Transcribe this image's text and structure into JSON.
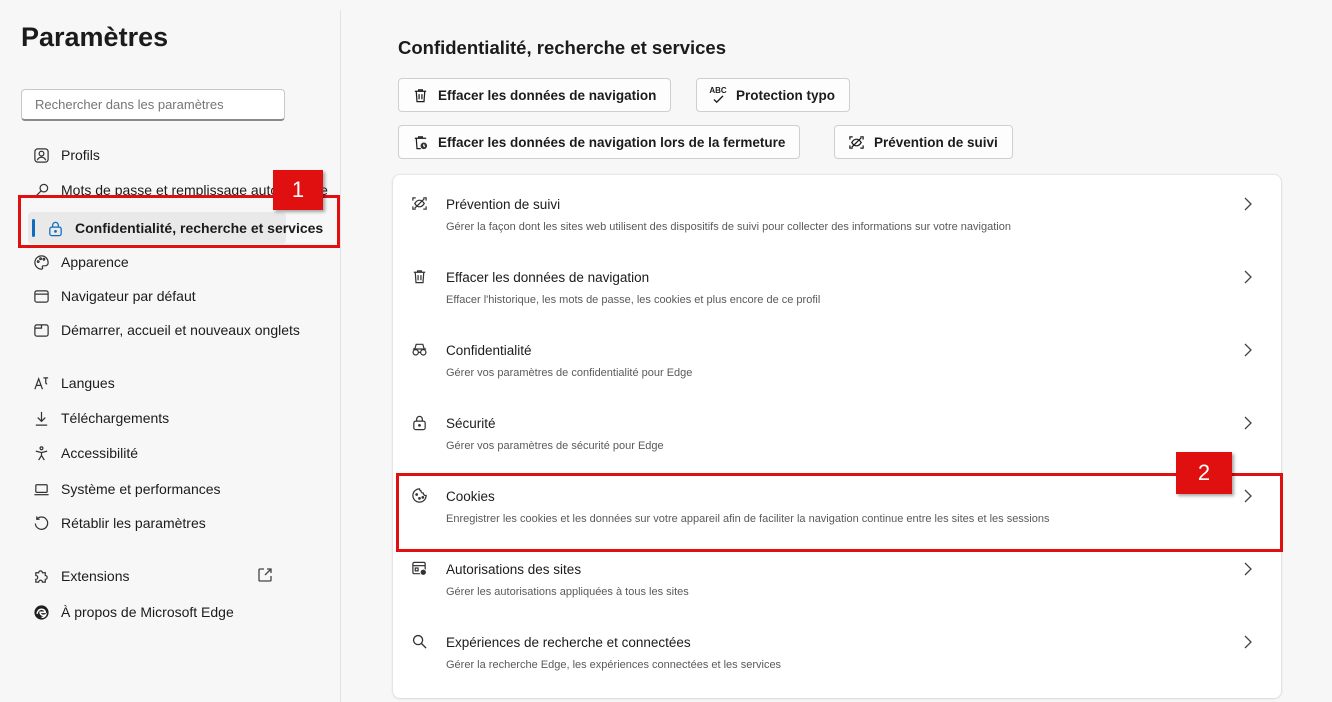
{
  "sidebar": {
    "title": "Paramètres",
    "search_placeholder": "Rechercher dans les paramètres",
    "items": [
      {
        "label": "Profils",
        "icon": "profile-icon"
      },
      {
        "label": "Mots de passe et remplissage automatique",
        "icon": "key-icon"
      },
      {
        "label": "Confidentialité, recherche et services",
        "icon": "lock-icon",
        "active": true
      },
      {
        "label": "Apparence",
        "icon": "palette-icon"
      },
      {
        "label": "Navigateur par défaut",
        "icon": "browser-icon"
      },
      {
        "label": "Démarrer, accueil et nouveaux onglets",
        "icon": "tab-icon"
      },
      {
        "label": "Langues",
        "icon": "language-icon"
      },
      {
        "label": "Téléchargements",
        "icon": "download-icon"
      },
      {
        "label": "Accessibilité",
        "icon": "accessibility-icon"
      },
      {
        "label": "Système et performances",
        "icon": "laptop-icon"
      },
      {
        "label": "Rétablir les paramètres",
        "icon": "reset-icon"
      },
      {
        "label": "Extensions",
        "icon": "puzzle-icon"
      },
      {
        "label": "À propos de Microsoft Edge",
        "icon": "edge-logo-icon"
      }
    ]
  },
  "main": {
    "title": "Confidentialité, recherche et services",
    "quick_buttons": [
      {
        "label": "Effacer les données de navigation",
        "icon": "trash-icon"
      },
      {
        "label": "Protection typo",
        "icon": "spellcheck-icon",
        "icon_text": "ABC"
      },
      {
        "label": "Effacer les données de navigation lors de la fermeture",
        "icon": "trash-clock-icon"
      },
      {
        "label": "Prévention de suivi",
        "icon": "tracking-icon"
      }
    ],
    "rows": [
      {
        "label": "Prévention de suivi",
        "desc": "Gérer la façon dont les sites web utilisent des dispositifs de suivi pour collecter des informations sur votre navigation",
        "icon": "tracking-icon"
      },
      {
        "label": "Effacer les données de navigation",
        "desc": "Effacer l'historique, les mots de passe, les cookies et plus encore de ce profil",
        "icon": "trash-icon"
      },
      {
        "label": "Confidentialité",
        "desc": "Gérer vos paramètres de confidentialité pour Edge",
        "icon": "glasses-icon"
      },
      {
        "label": "Sécurité",
        "desc": "Gérer vos paramètres de sécurité pour Edge",
        "icon": "lock-icon"
      },
      {
        "label": "Cookies",
        "desc": "Enregistrer les cookies et les données sur votre appareil afin de faciliter la navigation continue entre les sites et les sessions",
        "icon": "cookie-icon"
      },
      {
        "label": "Autorisations des sites",
        "desc": "Gérer les autorisations appliquées à tous les sites",
        "icon": "site-permissions-icon"
      },
      {
        "label": "Expériences de recherche et connectées",
        "desc": "Gérer la recherche Edge, les expériences connectées et les services",
        "icon": "search-icon"
      }
    ]
  },
  "annotations": [
    {
      "number": "1"
    },
    {
      "number": "2"
    }
  ],
  "colors": {
    "accent": "#0f6cbd",
    "annotation": "#e01010"
  }
}
